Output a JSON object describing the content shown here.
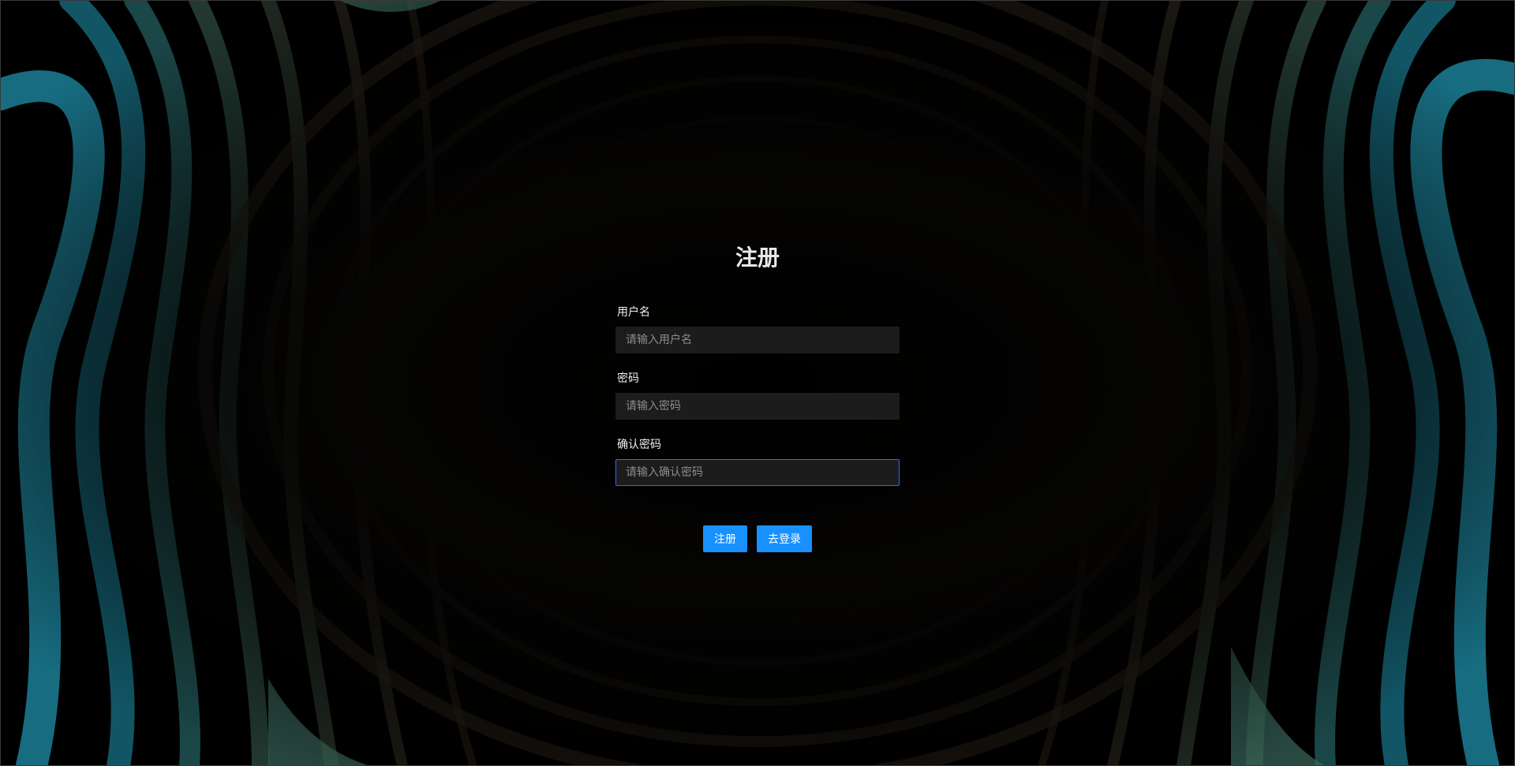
{
  "page": {
    "title": "注册"
  },
  "form": {
    "username": {
      "label": "用户名",
      "placeholder": "请输入用户名",
      "value": ""
    },
    "password": {
      "label": "密码",
      "placeholder": "请输入密码",
      "value": ""
    },
    "confirm_password": {
      "label": "确认密码",
      "placeholder": "请输入确认密码",
      "value": ""
    }
  },
  "actions": {
    "register_label": "注册",
    "go_login_label": "去登录"
  },
  "theme": {
    "accent": "#1890ff",
    "focus_border": "#1677ff",
    "input_bg": "#1c1c1c",
    "background": "#000000",
    "swirl_teal": "#1e8aa3",
    "swirl_green": "#4d7a6a",
    "swirl_brown": "#3a2a1e"
  }
}
